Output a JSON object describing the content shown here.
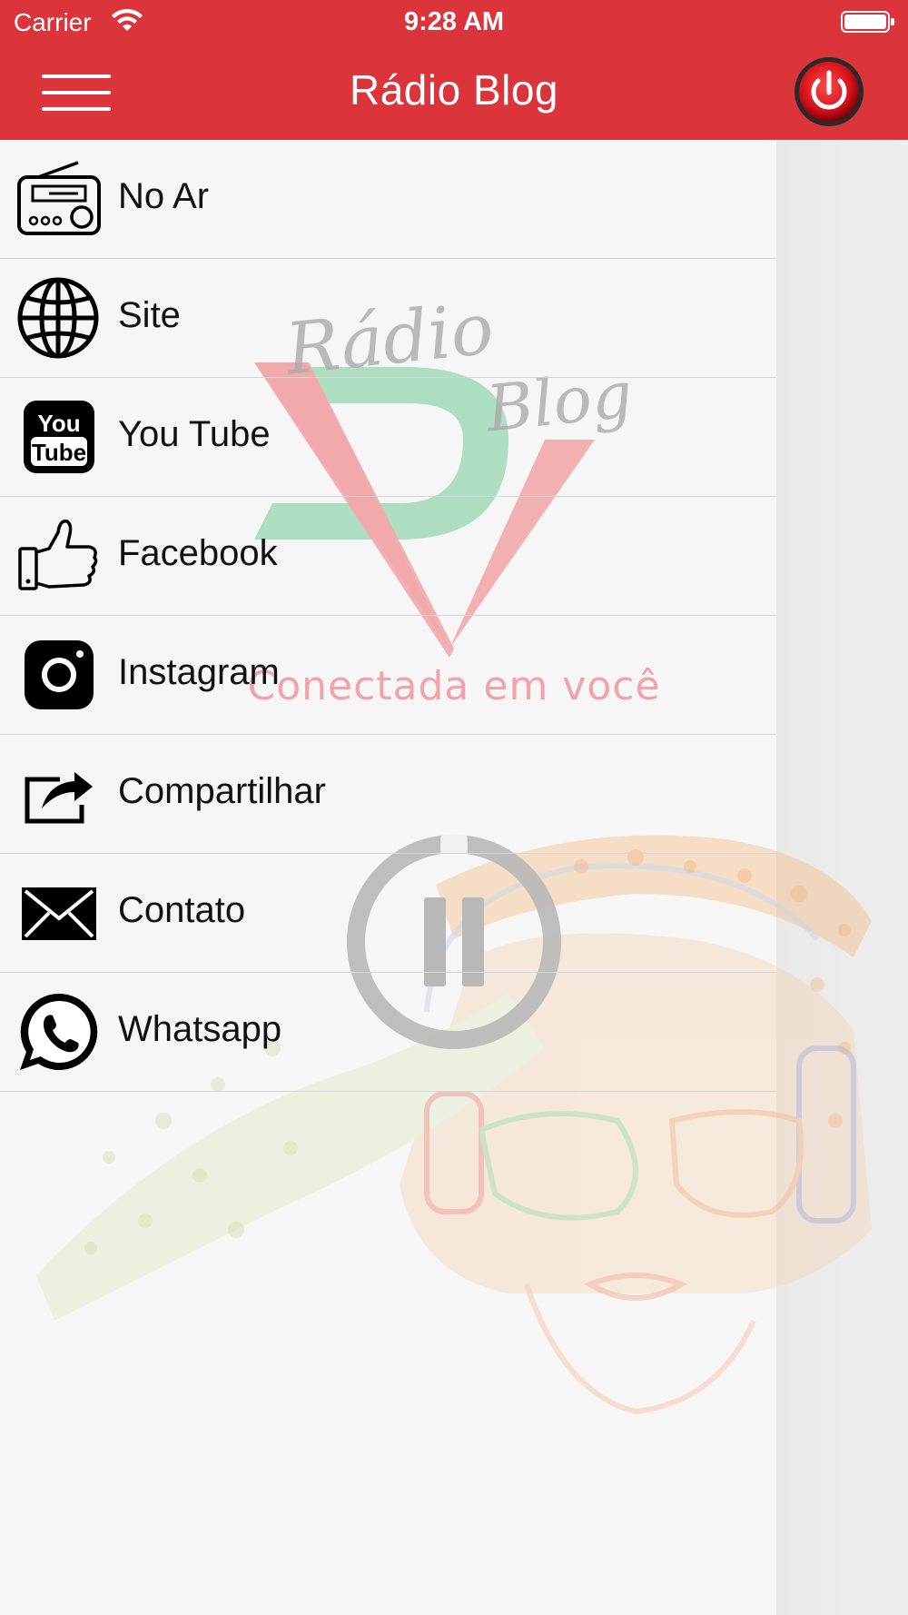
{
  "status_bar": {
    "carrier": "Carrier",
    "time": "9:28 AM",
    "wifi_icon": "wifi-icon",
    "battery_icon": "battery-icon"
  },
  "nav": {
    "title": "Rádio Blog",
    "menu_icon": "hamburger-menu-icon",
    "power_icon": "power-icon",
    "bar_color": "#dc343b"
  },
  "menu": {
    "items": [
      {
        "label": "No Ar",
        "icon": "radio-icon"
      },
      {
        "label": "Site",
        "icon": "globe-icon"
      },
      {
        "label": "You Tube",
        "icon": "youtube-icon"
      },
      {
        "label": "Facebook",
        "icon": "thumbs-up-icon"
      },
      {
        "label": "Instagram",
        "icon": "instagram-icon"
      },
      {
        "label": "Compartilhar",
        "icon": "share-icon"
      },
      {
        "label": "Contato",
        "icon": "envelope-icon"
      },
      {
        "label": "Whatsapp",
        "icon": "whatsapp-icon"
      }
    ]
  },
  "background": {
    "logo_text": "Rádio Blog",
    "tagline": "Conectada em você",
    "player_icon": "pause-icon"
  }
}
